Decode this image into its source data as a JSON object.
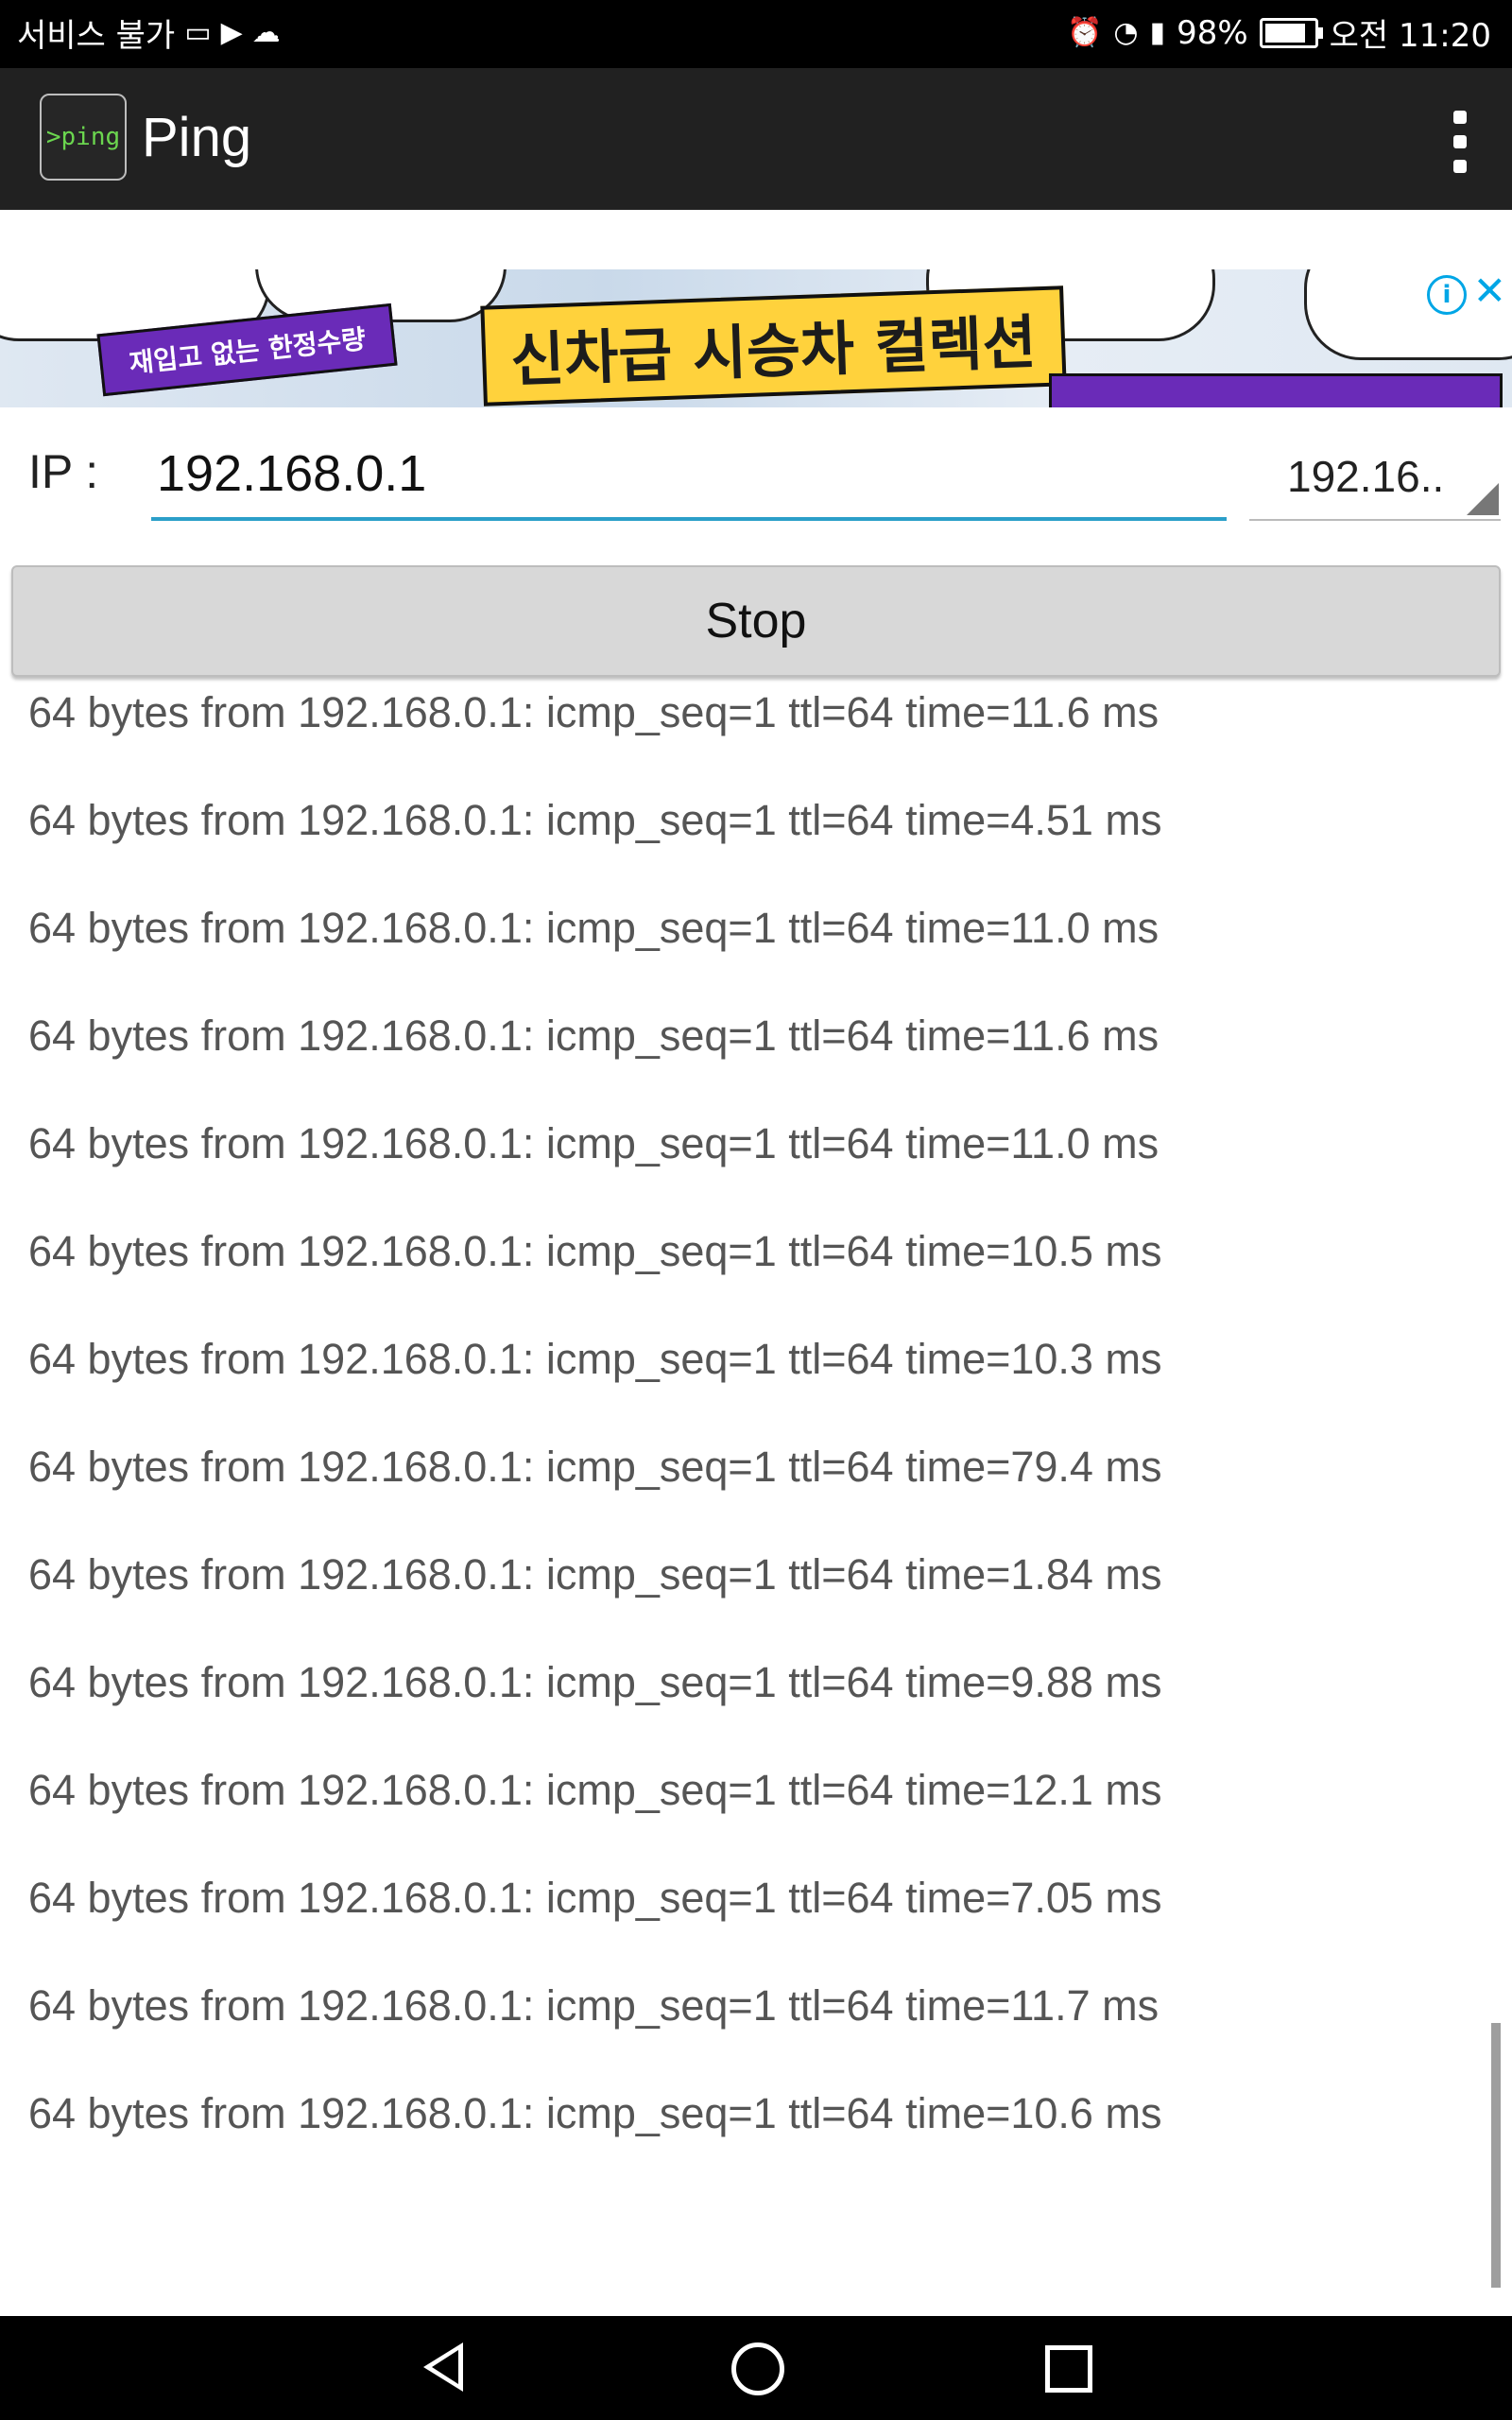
{
  "status_bar": {
    "left_text": "서비스 불가",
    "left_icons": [
      "gallery-icon",
      "play-store-icon",
      "cloud-icon"
    ],
    "right_icons": [
      "alarm-icon",
      "wifi-icon",
      "signal-icon",
      "battery-icon"
    ],
    "battery_percent": "98%",
    "time": "오전 11:20"
  },
  "app_bar": {
    "logo_text": ">ping",
    "title": "Ping"
  },
  "ad": {
    "tag": "재입고 없는 한정수량",
    "headline": "신차급 시승차 컬렉션"
  },
  "form": {
    "ip_label": "IP :",
    "ip_value": "192.168.0.1",
    "spinner_value": "192.16..",
    "stop_label": "Stop"
  },
  "log": {
    "lines": [
      "64 bytes from 192.168.0.1: icmp_seq=1 ttl=64 time=11.6 ms",
      "64 bytes from 192.168.0.1: icmp_seq=1 ttl=64 time=4.51 ms",
      "64 bytes from 192.168.0.1: icmp_seq=1 ttl=64 time=11.0 ms",
      "64 bytes from 192.168.0.1: icmp_seq=1 ttl=64 time=11.6 ms",
      "64 bytes from 192.168.0.1: icmp_seq=1 ttl=64 time=11.0 ms",
      "64 bytes from 192.168.0.1: icmp_seq=1 ttl=64 time=10.5 ms",
      "64 bytes from 192.168.0.1: icmp_seq=1 ttl=64 time=10.3 ms",
      "64 bytes from 192.168.0.1: icmp_seq=1 ttl=64 time=79.4 ms",
      "64 bytes from 192.168.0.1: icmp_seq=1 ttl=64 time=1.84 ms",
      "64 bytes from 192.168.0.1: icmp_seq=1 ttl=64 time=9.88 ms",
      "64 bytes from 192.168.0.1: icmp_seq=1 ttl=64 time=12.1 ms",
      "64 bytes from 192.168.0.1: icmp_seq=1 ttl=64 time=7.05 ms",
      "64 bytes from 192.168.0.1: icmp_seq=1 ttl=64 time=11.7 ms",
      "64 bytes from 192.168.0.1: icmp_seq=1 ttl=64 time=10.6 ms"
    ]
  },
  "colors": {
    "accent": "#2b9fc9",
    "app_bar": "#212121",
    "button": "#d8d8d8"
  }
}
